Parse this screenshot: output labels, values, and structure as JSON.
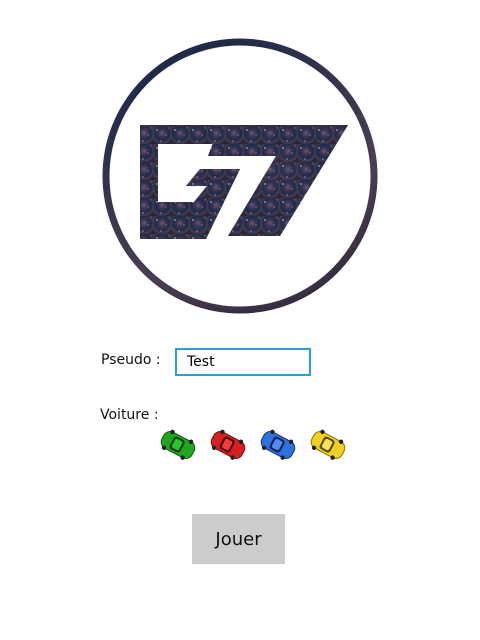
{
  "logo": {
    "icon": "g7-galaxy-logo"
  },
  "form": {
    "pseudo_label": "Pseudo :",
    "pseudo_value": "Test",
    "voiture_label": "Voiture :",
    "cars": [
      {
        "name": "green-car",
        "color": "#1fa51f"
      },
      {
        "name": "red-car",
        "color": "#d42020"
      },
      {
        "name": "blue-car",
        "color": "#2f6fe0"
      },
      {
        "name": "yellow-car",
        "color": "#f0d020"
      }
    ]
  },
  "actions": {
    "play_label": "Jouer"
  },
  "colors": {
    "input_border": "#2b9fd9",
    "button_bg": "#cccccc"
  }
}
